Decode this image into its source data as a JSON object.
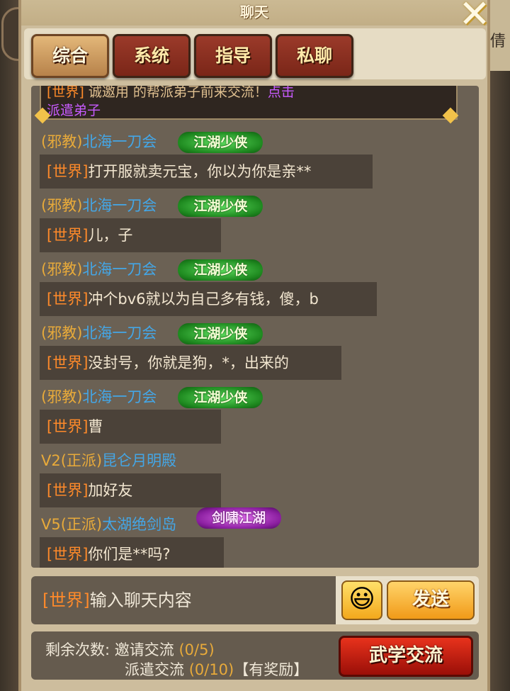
{
  "window": {
    "title": "聊天",
    "close_label": "✕"
  },
  "background": {
    "side_char": "倩"
  },
  "tabs": [
    {
      "label": "综合",
      "active": true
    },
    {
      "label": "系统",
      "active": false
    },
    {
      "label": "指导",
      "active": false
    },
    {
      "label": "私聊",
      "active": false
    }
  ],
  "notice": {
    "line1_tag": "[世界]",
    "line1_text": " 诚邀用 的帮派弟子前来交流！",
    "line1_link": "点击",
    "line2": "派遣弟子"
  },
  "messages": [
    {
      "prefix": "(邪教)",
      "name": "北海一刀会",
      "badge": "江湖少侠",
      "tag": "[世界]",
      "text": "打开服就卖元宝，你以为你是亲**"
    },
    {
      "prefix": "(邪教)",
      "name": "北海一刀会",
      "badge": "江湖少侠",
      "tag": "[世界]",
      "text": "儿，子"
    },
    {
      "prefix": "(邪教)",
      "name": "北海一刀会",
      "badge": "江湖少侠",
      "tag": "[世界]",
      "text": "冲个bv6就以为自己多有钱，傻，b"
    },
    {
      "prefix": "(邪教)",
      "name": "北海一刀会",
      "badge": "江湖少侠",
      "tag": "[世界]",
      "text": "没封号，你就是狗，*，出来的"
    },
    {
      "prefix": "(邪教)",
      "name": "北海一刀会",
      "badge": "江湖少侠",
      "tag": "[世界]",
      "text": "曹"
    },
    {
      "prefix": "V2(正派)",
      "name": "昆仑月明殿",
      "badge": "",
      "tag": "[世界]",
      "text": "加好友"
    },
    {
      "prefix": "V5(正派)",
      "name": "太湖绝剑岛",
      "badge": "剑啸江湖",
      "tag": "[世界]",
      "text": "你们是**吗?"
    }
  ],
  "input": {
    "tag": "[世界]",
    "placeholder": "输入聊天内容"
  },
  "buttons": {
    "emoji": "😃",
    "send": "发送",
    "exchange": "武学交流"
  },
  "footer": {
    "label": "剩余次数:",
    "invite_label": "邀请交流",
    "invite_count": "(0/5)",
    "dispatch_label": "派遣交流",
    "dispatch_count": "(0/10)",
    "reward": "【有奖励】"
  }
}
